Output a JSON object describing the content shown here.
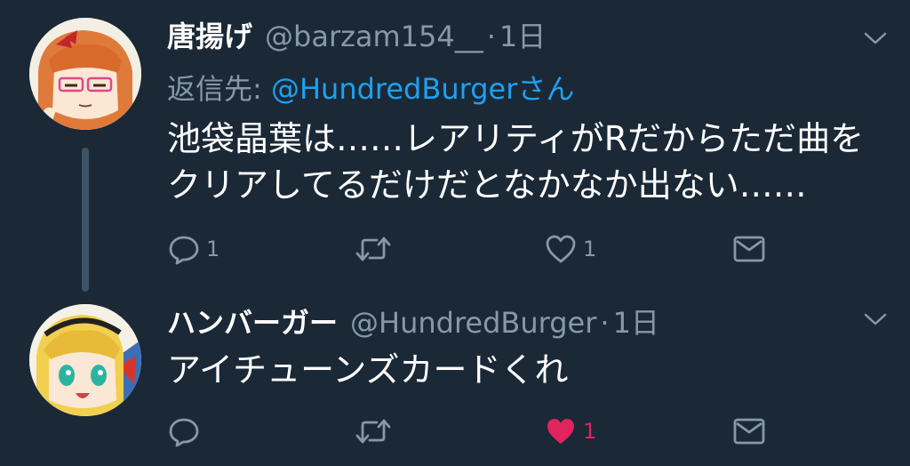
{
  "colors": {
    "background": "#1b2836",
    "secondary_text": "#8899a6",
    "link": "#1da1f2",
    "like_active": "#e0245e"
  },
  "tweets": [
    {
      "display_name": "唐揚げ",
      "handle": "@barzam154__",
      "separator": "·",
      "time": "1日",
      "reply_to_label": "返信先:",
      "reply_to_mention": "@HundredBurgerさん",
      "text_lines": [
        "池袋晶葉は……レアリティがRだからただ曲を",
        "クリアしてるだけだとなかなか出ない……"
      ],
      "actions": {
        "reply_icon": "comment-icon",
        "reply_count": "1",
        "retweet_icon": "retweet-icon",
        "retweet_count": "",
        "like_icon": "heart-outline-icon",
        "like_count": "1",
        "like_active": false,
        "dm_icon": "envelope-icon"
      }
    },
    {
      "display_name": "ハンバーガー",
      "handle": "@HundredBurger",
      "separator": "·",
      "time": "1日",
      "text_lines": [
        "アイチューンズカードくれ"
      ],
      "actions": {
        "reply_icon": "comment-icon",
        "reply_count": "",
        "retweet_icon": "retweet-icon",
        "retweet_count": "",
        "like_icon": "heart-filled-icon",
        "like_count": "1",
        "like_active": true,
        "dm_icon": "envelope-icon"
      }
    }
  ]
}
